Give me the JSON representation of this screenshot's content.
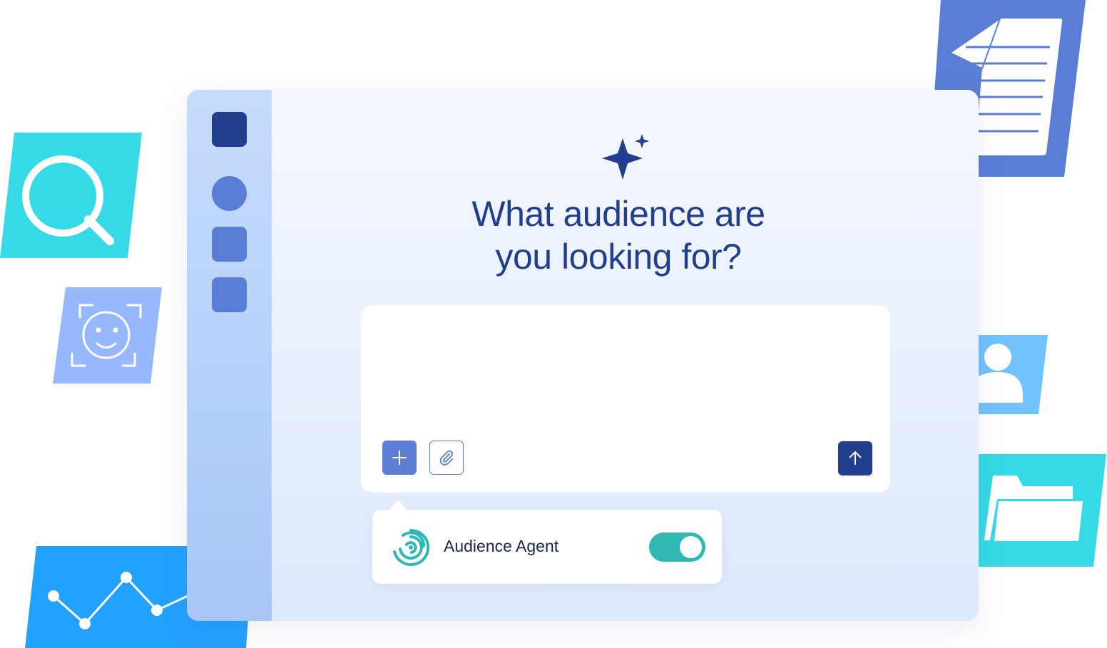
{
  "main": {
    "headline_line1": "What audience are",
    "headline_line2": "you looking for?"
  },
  "composer": {
    "value": "",
    "placeholder": ""
  },
  "agent_popover": {
    "label": "Audience Agent",
    "toggle_on": true
  },
  "icons": {
    "sidebar": [
      "square-icon",
      "circle-icon",
      "square-icon",
      "square-icon"
    ],
    "composer": [
      "plus-icon",
      "paperclip-icon",
      "arrow-up-icon"
    ],
    "decorative": [
      "search-icon",
      "face-scan-icon",
      "line-chart-icon",
      "document-icon",
      "user-icon",
      "folder-icon",
      "sparkle-icon",
      "audience-agent-icon"
    ]
  },
  "colors": {
    "navy": "#213e8f",
    "primary": "#5a7ed6",
    "cyan": "#36dae6",
    "sky": "#72c2fc",
    "periwinkle": "#98b8fd",
    "chart_blue": "#23a1ff",
    "teal": "#2fb8b4"
  }
}
